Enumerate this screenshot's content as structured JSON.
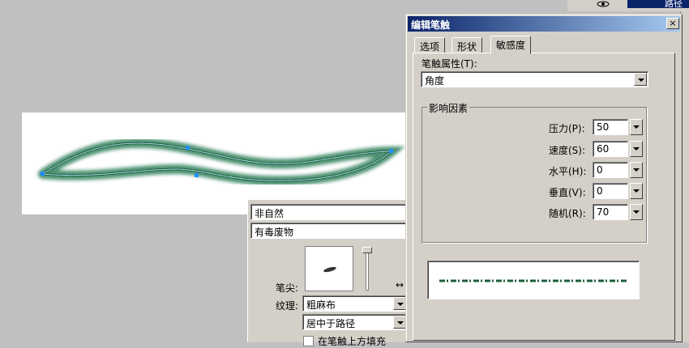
{
  "top_strip": {
    "path_tab": "路径"
  },
  "back_panel": {
    "category_value": "非自然",
    "type_value": "有毒废物",
    "tip_label": "笔尖:",
    "texture_label": "纹理:",
    "texture_value": "粗麻布",
    "position_value": "居中于路径",
    "fill_checkbox_label": "在笔触上方填充"
  },
  "dialog": {
    "title": "编辑笔触",
    "close_glyph": "×",
    "tabs": [
      {
        "label": "选项"
      },
      {
        "label": "形状"
      },
      {
        "label": "敏感度"
      }
    ],
    "property_label": "笔触属性(T):",
    "property_value": "角度",
    "group_title": "影响因素",
    "fields": [
      {
        "label": "压力(P):",
        "value": "50"
      },
      {
        "label": "速度(S):",
        "value": "60"
      },
      {
        "label": "水平(H):",
        "value": "0"
      },
      {
        "label": "垂直(V):",
        "value": "0"
      },
      {
        "label": "随机(R):",
        "value": "70"
      }
    ]
  },
  "colors": {
    "stroke_green": "#2f7f5a",
    "stroke_dark": "#1d5e3c",
    "title_blue": "#0a246a",
    "selection_blue": "#1e90ff"
  }
}
